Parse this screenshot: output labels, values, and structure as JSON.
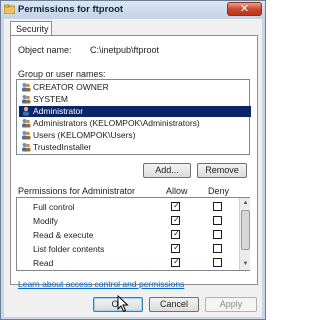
{
  "window": {
    "title": "Permissions for ftproot",
    "close_glyph": "✕",
    "title_icon": "folder-permissions-icon"
  },
  "tabs": [
    {
      "label": "Security"
    }
  ],
  "object": {
    "label": "Object name:",
    "value": "C:\\inetpub\\ftproot"
  },
  "groups": {
    "label": "Group or user names:",
    "items": [
      {
        "label": "CREATOR OWNER",
        "selected": false
      },
      {
        "label": "SYSTEM",
        "selected": false
      },
      {
        "label": "Administrator",
        "selected": true
      },
      {
        "label": "Administrators (KELOMPOK\\Administrators)",
        "selected": false
      },
      {
        "label": "Users (KELOMPOK\\Users)",
        "selected": false
      },
      {
        "label": "TrustedInstaller",
        "selected": false
      }
    ],
    "add_label": "Add...",
    "remove_label": "Remove"
  },
  "permissions": {
    "header_label": "Permissions for Administrator",
    "allow_label": "Allow",
    "deny_label": "Deny",
    "check_glyph": "✓",
    "rows": [
      {
        "label": "Full control",
        "allow": true,
        "deny": false
      },
      {
        "label": "Modify",
        "allow": true,
        "deny": false
      },
      {
        "label": "Read & execute",
        "allow": true,
        "deny": false
      },
      {
        "label": "List folder contents",
        "allow": true,
        "deny": false
      },
      {
        "label": "Read",
        "allow": true,
        "deny": false
      }
    ]
  },
  "link_label": "Learn about access control and permissions",
  "footer": {
    "ok_label": "OK",
    "cancel_label": "Cancel",
    "apply_label": "Apply"
  }
}
